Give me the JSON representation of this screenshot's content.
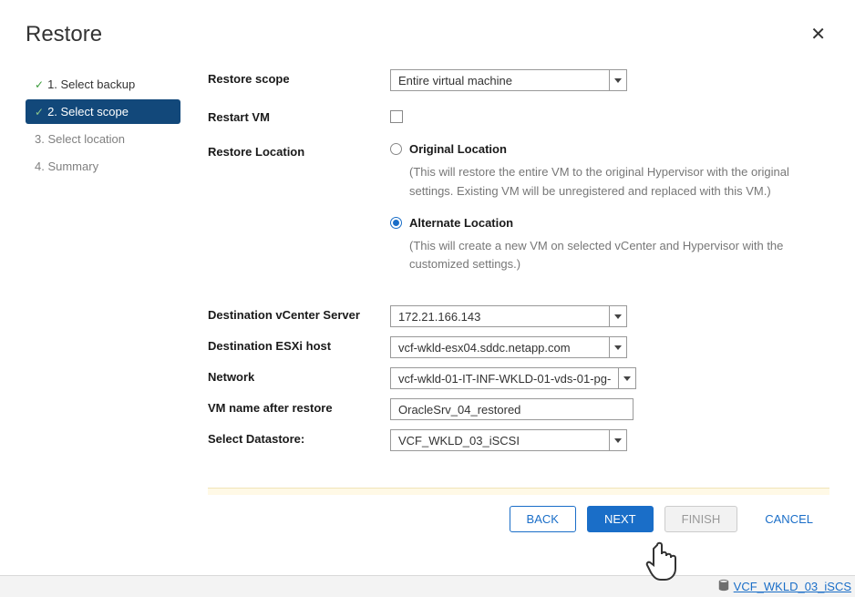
{
  "dialog": {
    "title": "Restore"
  },
  "steps": [
    {
      "label": "1. Select backup",
      "state": "done"
    },
    {
      "label": "2. Select scope",
      "state": "active"
    },
    {
      "label": "3. Select location",
      "state": "pending"
    },
    {
      "label": "4. Summary",
      "state": "pending"
    }
  ],
  "form": {
    "restoreScope": {
      "label": "Restore scope",
      "value": "Entire virtual machine"
    },
    "restartVm": {
      "label": "Restart VM",
      "checked": false
    },
    "restoreLocation": {
      "label": "Restore Location",
      "options": {
        "original": {
          "label": "Original Location",
          "help": "(This will restore the entire VM to the original Hypervisor with the original settings. Existing VM will be unregistered and replaced with this VM.)",
          "selected": false
        },
        "alternate": {
          "label": "Alternate Location",
          "help": "(This will create a new VM on selected vCenter and Hypervisor with the customized settings.)",
          "selected": true
        }
      }
    },
    "destVcenter": {
      "label": "Destination vCenter Server",
      "value": "172.21.166.143"
    },
    "destEsxi": {
      "label": "Destination ESXi host",
      "value": "vcf-wkld-esx04.sddc.netapp.com"
    },
    "network": {
      "label": "Network",
      "value": "vcf-wkld-01-IT-INF-WKLD-01-vds-01-pg-"
    },
    "vmName": {
      "label": "VM name after restore",
      "value": "OracleSrv_04_restored"
    },
    "datastore": {
      "label": "Select Datastore:",
      "value": "VCF_WKLD_03_iSCSI"
    }
  },
  "footer": {
    "back": "BACK",
    "next": "NEXT",
    "finish": "FINISH",
    "cancel": "CANCEL"
  },
  "behind": {
    "link": "VCF_WKLD_03_iSCS"
  }
}
